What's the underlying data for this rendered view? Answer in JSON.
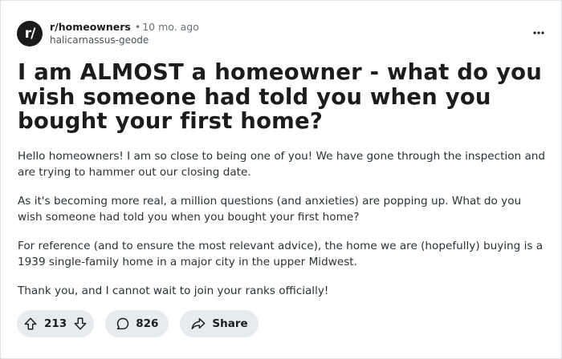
{
  "post": {
    "subreddit": "r/homeowners",
    "separator": "•",
    "time": "10 mo. ago",
    "author": "halicarnassus-geode",
    "avatar_text": "r/",
    "title": "I am ALMOST a homeowner - what do you wish someone had told you when you bought your first home?",
    "body": [
      "Hello homeowners! I am so close to being one of you! We have gone through the inspection and are trying to hammer out our closing date.",
      "As it's becoming more real, a million questions (and anxieties) are popping up. What do you wish someone had told you when you bought your first home?",
      "For reference (and to ensure the most relevant advice), the home we are (hopefully) buying is a 1939 single-family home in a major city in the upper Midwest.",
      "Thank you, and I cannot wait to join your ranks officially!"
    ]
  },
  "actions": {
    "upvote_icon": "arrow-up-icon",
    "downvote_icon": "arrow-down-icon",
    "votes": "213",
    "comment_icon": "comment-bubble-icon",
    "comments": "826",
    "share_icon": "share-arrow-icon",
    "share_label": "Share"
  },
  "menu_icon": "more-horizontal-icon",
  "colors": {
    "pill_bg": "#e5ebee",
    "text": "#1c1c1c",
    "muted": "#6b7378",
    "avatar_bg": "#1a1a1b"
  }
}
